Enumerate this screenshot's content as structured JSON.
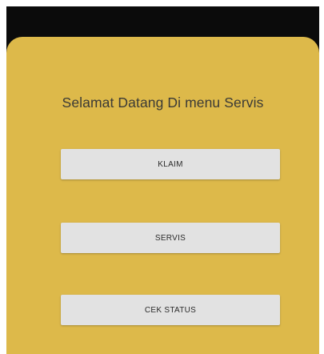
{
  "menu": {
    "title": "Selamat Datang Di menu Servis",
    "buttons": {
      "klaim": "KLAIM",
      "servis": "SERVIS",
      "cek_status": "CEK STATUS"
    }
  },
  "colors": {
    "status_bar": "#0b0b0b",
    "panel_background": "#ddb94a",
    "button_background": "#e2e2e2",
    "title_text": "#3b3a36"
  }
}
